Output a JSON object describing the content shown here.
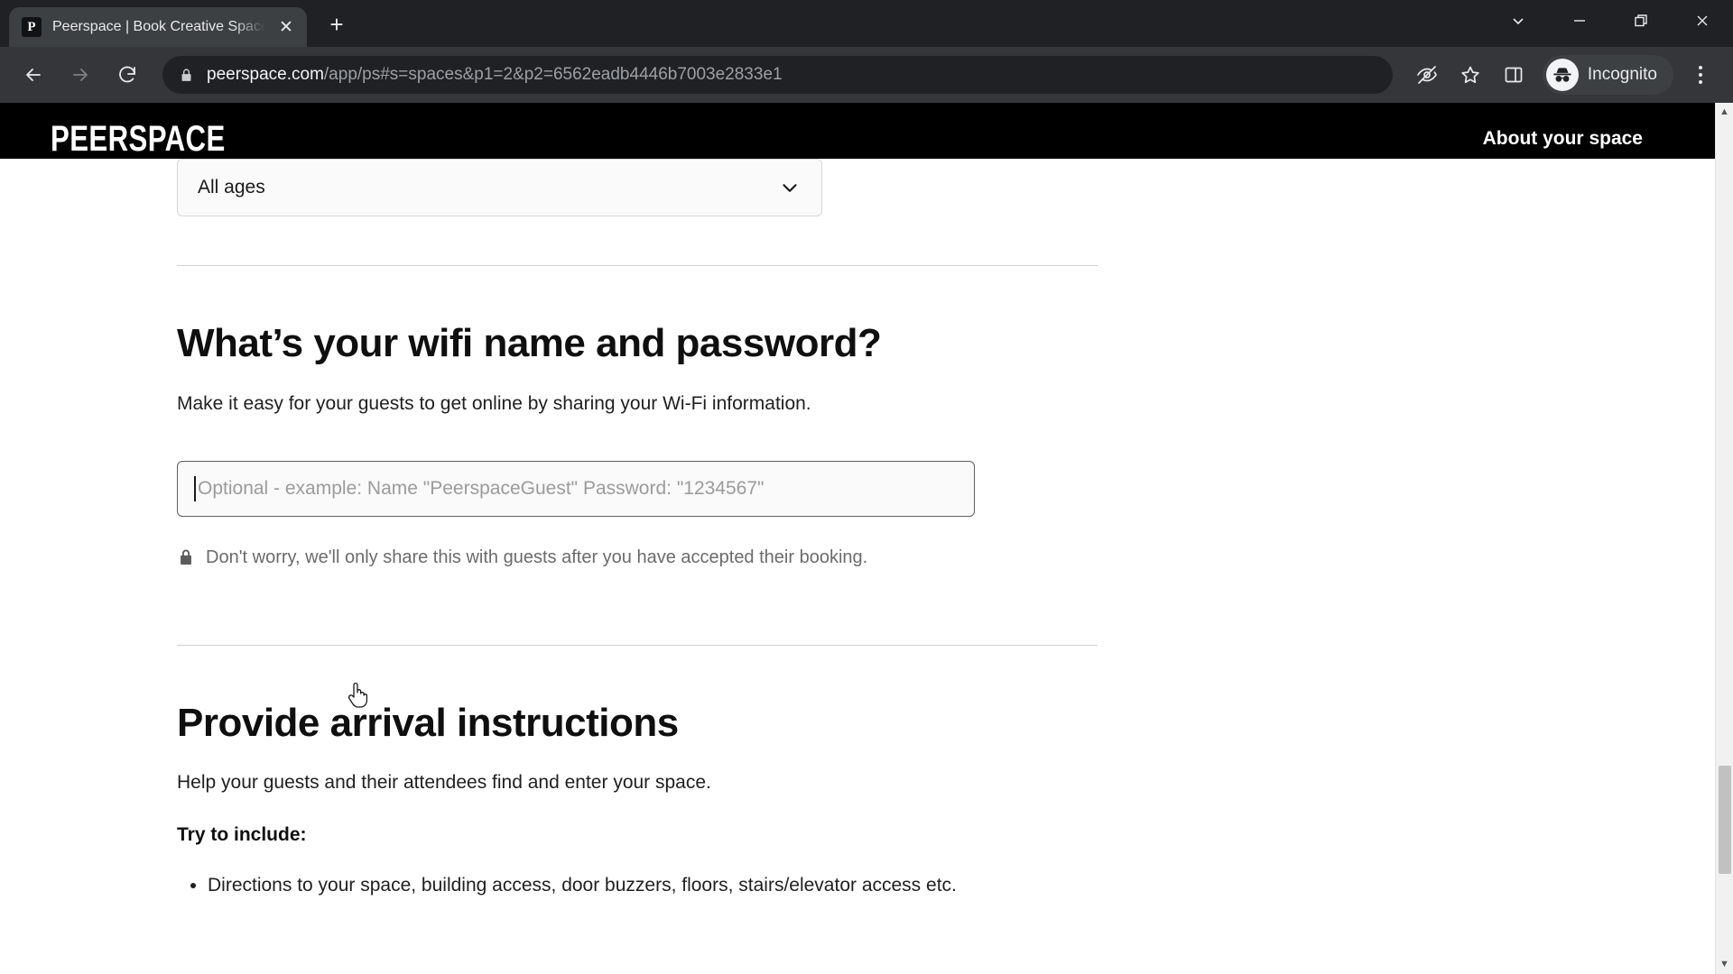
{
  "browser": {
    "tab": {
      "favicon_letter": "P",
      "title": "Peerspace | Book Creative Space",
      "close_label": "✕"
    },
    "new_tab_label": "+",
    "window_controls": [
      {
        "name": "tab-search",
        "label": "⌄"
      },
      {
        "name": "minimize",
        "label": "—"
      },
      {
        "name": "restore",
        "label": "❐"
      },
      {
        "name": "close",
        "label": "✕"
      }
    ],
    "nav": {
      "back_label": "←",
      "forward_label": "→",
      "reload_label": "↻"
    },
    "omnibox": {
      "host": "peerspace.com",
      "path": "/app/ps#s=spaces&p1=2&p2=6562eadb4446b7003e2833e1",
      "full_url": "peerspace.com/app/ps#s=spaces&p1=2&p2=6562eadb4446b7003e2833e1"
    },
    "toolbar_icons": [
      {
        "name": "tracking-protection-icon"
      },
      {
        "name": "bookmark-star-icon"
      },
      {
        "name": "side-panel-icon"
      }
    ],
    "profile": {
      "label": "Incognito"
    },
    "menu_label": "⋮"
  },
  "site": {
    "logo_text": "PEERSPACE",
    "header_link": "About your space"
  },
  "form": {
    "age_select": {
      "value": "All ages",
      "chevron": "chevron-down-icon"
    },
    "wifi": {
      "title": "What’s your wifi name and password?",
      "subtitle": "Make it easy for your guests to get online by sharing your Wi-Fi information.",
      "input_value": "",
      "input_placeholder": "Optional - example: Name \"PeerspaceGuest\" Password: \"1234567\"",
      "privacy_note": "Don't worry, we'll only share this with guests after you have accepted their booking."
    },
    "arrival": {
      "title": "Provide arrival instructions",
      "subtitle": "Help your guests and their attendees find and enter your space.",
      "try_label": "Try to include:",
      "bullets": [
        "Directions to your space, building access, door buzzers, floors, stairs/elevator access etc."
      ]
    }
  },
  "colors": {
    "chrome_bg": "#202124",
    "toolbar_bg": "#35363a",
    "header_bg": "#000000",
    "page_bg": "#ffffff",
    "muted_text": "#6b6b6b",
    "placeholder_text": "#9b9b9b"
  },
  "scrollbar": {
    "up_arrow": "▲",
    "down_arrow": "▼"
  }
}
